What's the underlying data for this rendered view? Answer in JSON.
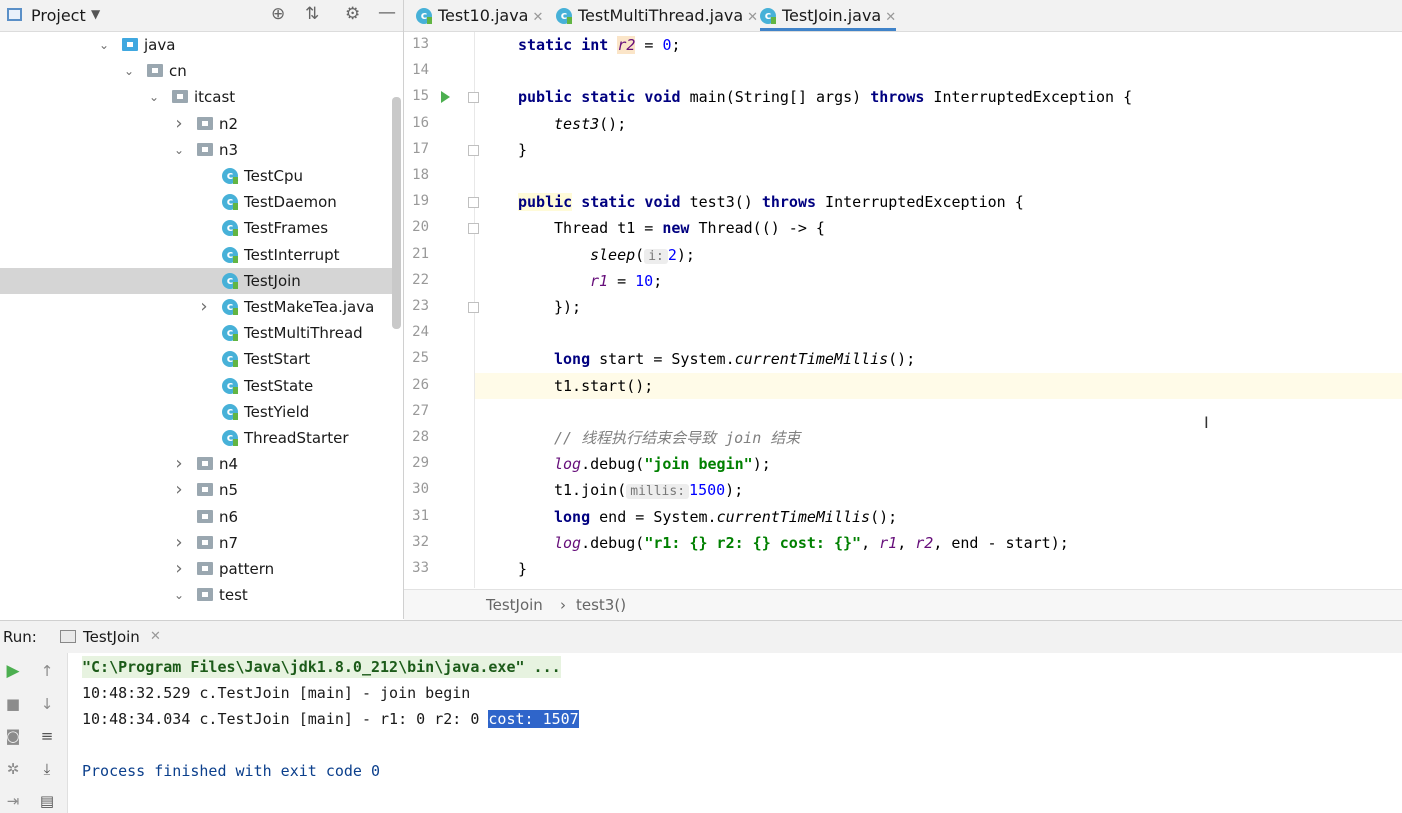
{
  "project": {
    "title": "Project",
    "tree": [
      {
        "label": "java",
        "indent": 0,
        "chev": "down",
        "icon": "folder-blue"
      },
      {
        "label": "cn",
        "indent": 1,
        "chev": "down",
        "icon": "folder"
      },
      {
        "label": "itcast",
        "indent": 2,
        "chev": "down",
        "icon": "folder"
      },
      {
        "label": "n2",
        "indent": 3,
        "chev": "right",
        "icon": "folder"
      },
      {
        "label": "n3",
        "indent": 3,
        "chev": "down",
        "icon": "folder"
      },
      {
        "label": "TestCpu",
        "indent": 4,
        "chev": "",
        "icon": "class"
      },
      {
        "label": "TestDaemon",
        "indent": 4,
        "chev": "",
        "icon": "class"
      },
      {
        "label": "TestFrames",
        "indent": 4,
        "chev": "",
        "icon": "class"
      },
      {
        "label": "TestInterrupt",
        "indent": 4,
        "chev": "",
        "icon": "class"
      },
      {
        "label": "TestJoin",
        "indent": 4,
        "chev": "",
        "icon": "class",
        "selected": true
      },
      {
        "label": "TestMakeTea.java",
        "indent": 4,
        "chev": "right",
        "icon": "class"
      },
      {
        "label": "TestMultiThread",
        "indent": 4,
        "chev": "",
        "icon": "class"
      },
      {
        "label": "TestStart",
        "indent": 4,
        "chev": "",
        "icon": "class"
      },
      {
        "label": "TestState",
        "indent": 4,
        "chev": "",
        "icon": "class"
      },
      {
        "label": "TestYield",
        "indent": 4,
        "chev": "",
        "icon": "class"
      },
      {
        "label": "ThreadStarter",
        "indent": 4,
        "chev": "",
        "icon": "class"
      },
      {
        "label": "n4",
        "indent": 3,
        "chev": "right",
        "icon": "folder"
      },
      {
        "label": "n5",
        "indent": 3,
        "chev": "right",
        "icon": "folder"
      },
      {
        "label": "n6",
        "indent": 3,
        "chev": "",
        "icon": "folder"
      },
      {
        "label": "n7",
        "indent": 3,
        "chev": "right",
        "icon": "folder"
      },
      {
        "label": "pattern",
        "indent": 3,
        "chev": "right",
        "icon": "folder"
      },
      {
        "label": "test",
        "indent": 3,
        "chev": "down",
        "icon": "folder"
      }
    ]
  },
  "tabs": [
    {
      "label": "Test10.java",
      "active": false
    },
    {
      "label": "TestMultiThread.java",
      "active": false
    },
    {
      "label": "TestJoin.java",
      "active": true
    }
  ],
  "editor": {
    "line_numbers": [
      "13",
      "14",
      "15",
      "16",
      "17",
      "18",
      "19",
      "20",
      "21",
      "22",
      "23",
      "24",
      "25",
      "26",
      "27",
      "28",
      "29",
      "30",
      "31",
      "32",
      "33"
    ],
    "code": {
      "l13_kw": "static int",
      "l13_field": "r2",
      "l13_rest": " = ",
      "l13_num": "0",
      "l13_end": ";",
      "l15_kw": "public static void",
      "l15_rest": " main(String[] args) ",
      "l15_kw2": "throws",
      "l15_end": " InterruptedException {",
      "l16": "test3",
      "l16_end": "();",
      "l17": "}",
      "l19_kw": "public",
      "l19_kw2": " static void",
      "l19_rest": " test3() ",
      "l19_kw3": "throws",
      "l19_end": " InterruptedException {",
      "l20_a": "Thread t1 = ",
      "l20_kw": "new",
      "l20_b": " Thread(() -> {",
      "l21_fn": "sleep",
      "l21_a": "(",
      "l21_hint": "i:",
      "l21_num": "2",
      "l21_end": ");",
      "l22_field": "r1",
      "l22_a": " = ",
      "l22_num": "10",
      "l22_end": ";",
      "l23": "});",
      "l25_kw": "long",
      "l25_a": " start = System.",
      "l25_fn": "currentTimeMillis",
      "l25_end": "();",
      "l26": "t1.start();",
      "l28": "// 线程执行结束会导致 join 结束",
      "l29_log": "log",
      "l29_a": ".debug(",
      "l29_str": "\"join begin\"",
      "l29_end": ");",
      "l30_a": "t1.join(",
      "l30_hint": "millis:",
      "l30_num": "1500",
      "l30_end": ");",
      "l31_kw": "long",
      "l31_a": " end = System.",
      "l31_fn": "currentTimeMillis",
      "l31_end": "();",
      "l32_log": "log",
      "l32_a": ".debug(",
      "l32_str": "\"r1: {} r2: {} cost: {}\"",
      "l32_b": ", ",
      "l32_f1": "r1",
      "l32_c": ", ",
      "l32_f2": "r2",
      "l32_end": ", end - start);",
      "l33": "}"
    }
  },
  "breadcrumb": {
    "class": "TestJoin",
    "sep": "›",
    "method": "test3()"
  },
  "run": {
    "label": "Run:",
    "tab": "TestJoin",
    "console": {
      "cmd": "\"C:\\Program Files\\Java\\jdk1.8.0_212\\bin\\java.exe\" ...",
      "line1": "10:48:32.529 c.TestJoin [main] - join begin",
      "line2_a": "10:48:34.034 c.TestJoin [main] - r1: 0 r2: 0 ",
      "line2_sel": "cost: 1507",
      "exit": "Process finished with exit code 0"
    }
  },
  "colors": {
    "accent": "#4083c9",
    "selection": "#2f65ca",
    "run_green": "#4caf50"
  }
}
